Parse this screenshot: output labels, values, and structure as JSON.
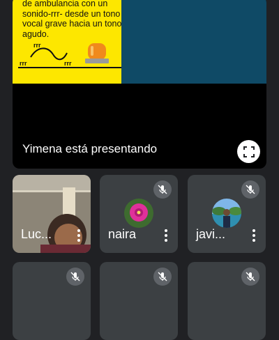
{
  "slide": {
    "text": "de ambulancia con un sonido-rrr- desde un tono vocal grave hacia un tono agudo.",
    "sound_label_left": "rrr",
    "sound_label_top": "rrr",
    "sound_label_right": "rrr"
  },
  "presenter_label": "Yimena está presentando",
  "participants": [
    {
      "name": "Luc..."
    },
    {
      "name": "naira"
    },
    {
      "name": "javi..."
    }
  ],
  "icons": {
    "fullscreen": "fullscreen-icon",
    "mic_off": "mic-off-icon",
    "more": "more-vert-icon"
  },
  "colors": {
    "slide_yellow": "#fde700",
    "slide_teal": "#0f4a66",
    "background": "#202124",
    "tile": "#3c4043"
  }
}
